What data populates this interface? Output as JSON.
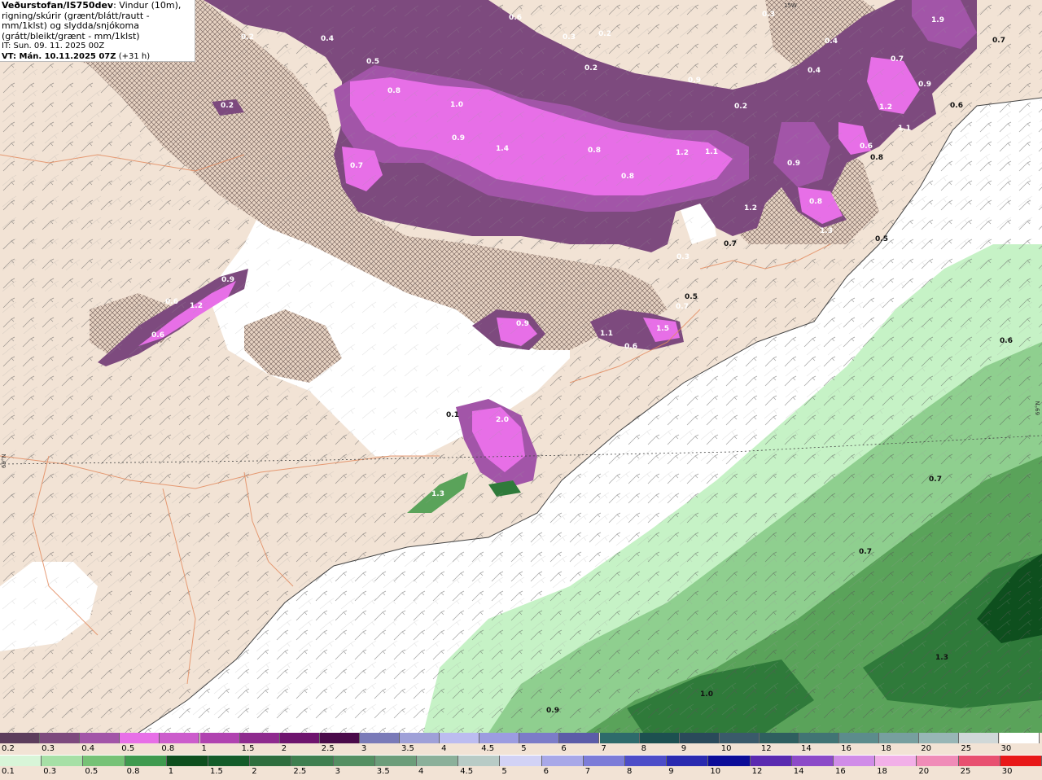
{
  "header": {
    "source": "Veðurstofan/IS750dev",
    "description": "Vindur (10m), rigning/skúrir (grænt/blátt/rautt - mm/1klst) og slydda/snjókoma (grátt/bleikt/grænt - mm/1klst)",
    "it_line": "IT: Sun. 09. 11. 2025 00Z",
    "vt_label": "VT: Mán. 10.11.2025 07Z",
    "vt_offset": "(+31 h)"
  },
  "colors": {
    "land": "#f2e3d5",
    "sea_white": "#ffffff",
    "ice": "#ffffff",
    "snow_light": "#7d4a7e",
    "snow_mid": "#a255a8",
    "snow_strong": "#e76fe7",
    "rain_light": "#c6f2c6",
    "rain_mid": "#8fcf8f",
    "rain_strong": "#5aa35a",
    "rain_heavy": "#2f7a3a",
    "rain_extreme": "#0e4f1e",
    "roads": "#e38c60",
    "coast": "#444444"
  },
  "snow_scale": {
    "labels": [
      "0.2",
      "0.3",
      "0.4",
      "0.5",
      "0.8",
      "1",
      "1.5",
      "2",
      "2.5",
      "3",
      "3.5",
      "4",
      "4.5",
      "5",
      "6",
      "7",
      "8",
      "9",
      "10",
      "12",
      "14",
      "16",
      "18",
      "20",
      "25",
      "30"
    ],
    "colors": [
      "#5c3d5c",
      "#7d4a7e",
      "#a255a8",
      "#e76fe7",
      "#cc5ccc",
      "#b043b0",
      "#8e2a8e",
      "#6e146e",
      "#4a0a4a",
      "#7a7ab8",
      "#9fa0d8",
      "#bcbcf0",
      "#9c9ce0",
      "#7c7cc8",
      "#5c5ca8",
      "#2e6b6b",
      "#1d5050",
      "#2a4a5a",
      "#3a5a6a",
      "#2f5f5f",
      "#417474",
      "#5c8c8c",
      "#779f9f",
      "#98b6b6",
      "#d0d8d8",
      "#ffffff"
    ]
  },
  "rain_scale": {
    "labels": [
      "0.1",
      "0.3",
      "0.5",
      "0.8",
      "1",
      "1.5",
      "2",
      "2.5",
      "3",
      "3.5",
      "4",
      "4.5",
      "5",
      "6",
      "7",
      "8",
      "9",
      "10",
      "12",
      "14",
      "16",
      "18",
      "20",
      "25",
      "30"
    ],
    "colors": [
      "#d8f5d8",
      "#a6e0a6",
      "#76c276",
      "#3f9a4f",
      "#0e4f1e",
      "#145c2a",
      "#2e6e3e",
      "#3f7f50",
      "#548f62",
      "#6c9d7a",
      "#8bb09a",
      "#b8cbc6",
      "#d2d2f5",
      "#a8a8e8",
      "#7c7cd8",
      "#4d4dc8",
      "#2a2ab0",
      "#0c0c98",
      "#5a2ab0",
      "#8c4ac8",
      "#d08ce8",
      "#f2b0e8",
      "#f08cb8",
      "#e85070",
      "#e81818"
    ]
  },
  "map_values": [
    {
      "text": "0.2"
    },
    {
      "text": "0.4"
    },
    {
      "text": "0.5"
    },
    {
      "text": "0.6"
    },
    {
      "text": "0.3"
    },
    {
      "text": "0.2"
    },
    {
      "text": "0.2"
    },
    {
      "text": "0.2"
    },
    {
      "text": "0.8"
    },
    {
      "text": "1.0"
    },
    {
      "text": "0.9"
    },
    {
      "text": "0.7"
    },
    {
      "text": "1.4"
    },
    {
      "text": "0.8"
    },
    {
      "text": "0.8"
    },
    {
      "text": "1.2"
    },
    {
      "text": "1.1"
    },
    {
      "text": "0.9"
    },
    {
      "text": "0.2"
    },
    {
      "text": "0.3"
    },
    {
      "text": "1.9"
    },
    {
      "text": "0.7"
    },
    {
      "text": "0.4"
    },
    {
      "text": "0.4"
    },
    {
      "text": "0.7"
    },
    {
      "text": "0.9"
    },
    {
      "text": "1.2"
    },
    {
      "text": "0.6"
    },
    {
      "text": "1.1"
    },
    {
      "text": "0.6"
    },
    {
      "text": "0.8"
    },
    {
      "text": "0.9"
    },
    {
      "text": "0.8"
    },
    {
      "text": "1.2"
    },
    {
      "text": "0.7"
    },
    {
      "text": "1.3"
    },
    {
      "text": "0.5"
    },
    {
      "text": "0.3"
    },
    {
      "text": "0.5"
    },
    {
      "text": "0.7"
    },
    {
      "text": "1.1"
    },
    {
      "text": "0.6"
    },
    {
      "text": "1.5"
    },
    {
      "text": "0.9"
    },
    {
      "text": "0.6"
    },
    {
      "text": "1.2"
    },
    {
      "text": "0.9"
    },
    {
      "text": "0.6"
    },
    {
      "text": "0.1"
    },
    {
      "text": "2.0"
    },
    {
      "text": "1.3"
    },
    {
      "text": "0.7"
    },
    {
      "text": "0.7"
    },
    {
      "text": "1.3"
    },
    {
      "text": "1.0"
    },
    {
      "text": "0.9"
    },
    {
      "text": "0.6"
    }
  ],
  "edge_labels": {
    "left": "69°N",
    "right": "69°N",
    "top": "15W"
  }
}
